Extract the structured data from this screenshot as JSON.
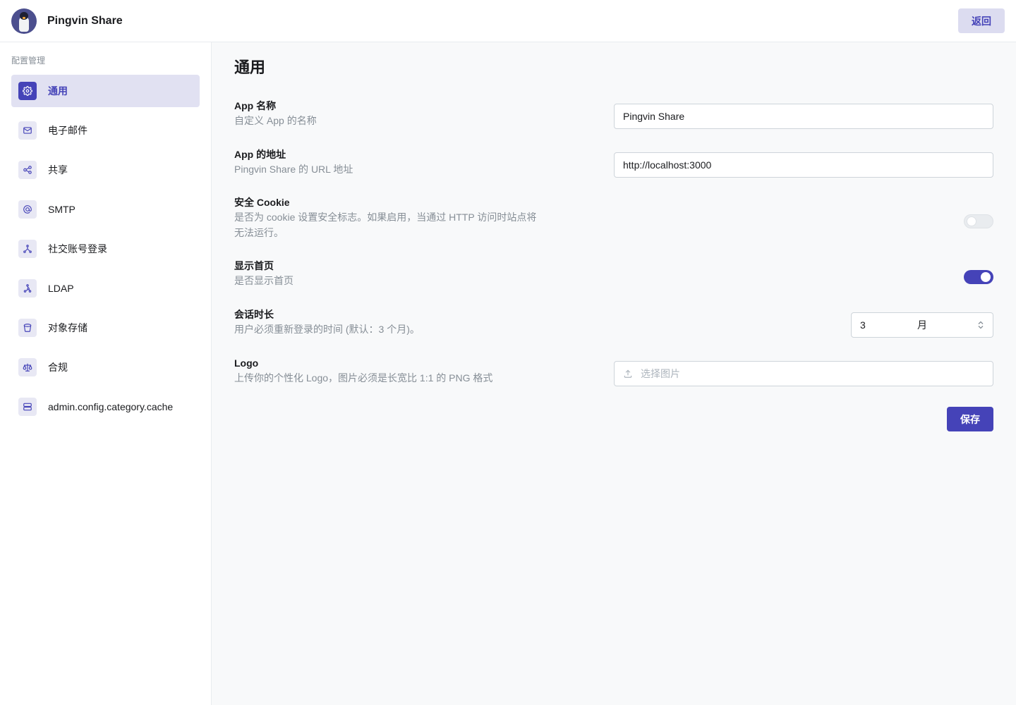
{
  "header": {
    "app_title": "Pingvin Share",
    "back_label": "返回"
  },
  "sidebar": {
    "heading": "配置管理",
    "items": [
      {
        "label": "通用",
        "icon": "gear-icon",
        "active": true
      },
      {
        "label": "电子邮件",
        "icon": "mail-icon",
        "active": false
      },
      {
        "label": "共享",
        "icon": "share-icon",
        "active": false
      },
      {
        "label": "SMTP",
        "icon": "at-icon",
        "active": false
      },
      {
        "label": "社交账号登录",
        "icon": "social-icon",
        "active": false
      },
      {
        "label": "LDAP",
        "icon": "ldap-icon",
        "active": false
      },
      {
        "label": "对象存储",
        "icon": "bucket-icon",
        "active": false
      },
      {
        "label": "合规",
        "icon": "scale-icon",
        "active": false
      },
      {
        "label": "admin.config.category.cache",
        "icon": "server-icon",
        "active": false
      }
    ]
  },
  "main": {
    "title": "通用",
    "settings": {
      "app_name": {
        "label": "App 名称",
        "desc": "自定义 App 的名称",
        "value": "Pingvin Share"
      },
      "app_url": {
        "label": "App 的地址",
        "desc": "Pingvin Share 的 URL 地址",
        "value": "http://localhost:3000"
      },
      "secure_cookie": {
        "label": "安全 Cookie",
        "desc": "是否为 cookie 设置安全标志。如果启用，当通过 HTTP 访问时站点将无法运行。",
        "enabled": false
      },
      "show_home": {
        "label": "显示首页",
        "desc": "是否显示首页",
        "enabled": true
      },
      "session_duration": {
        "label": "会话时长",
        "desc": "用户必须重新登录的时间 (默认：3 个月)。",
        "value": "3",
        "unit": "月"
      },
      "logo": {
        "label": "Logo",
        "desc": "上传你的个性化 Logo，图片必须是长宽比 1:1 的 PNG 格式",
        "placeholder": "选择图片"
      }
    },
    "save_label": "保存"
  },
  "colors": {
    "accent": "#4543b8",
    "accent_light": "#e1e1f2",
    "background": "#f8f9fa"
  }
}
